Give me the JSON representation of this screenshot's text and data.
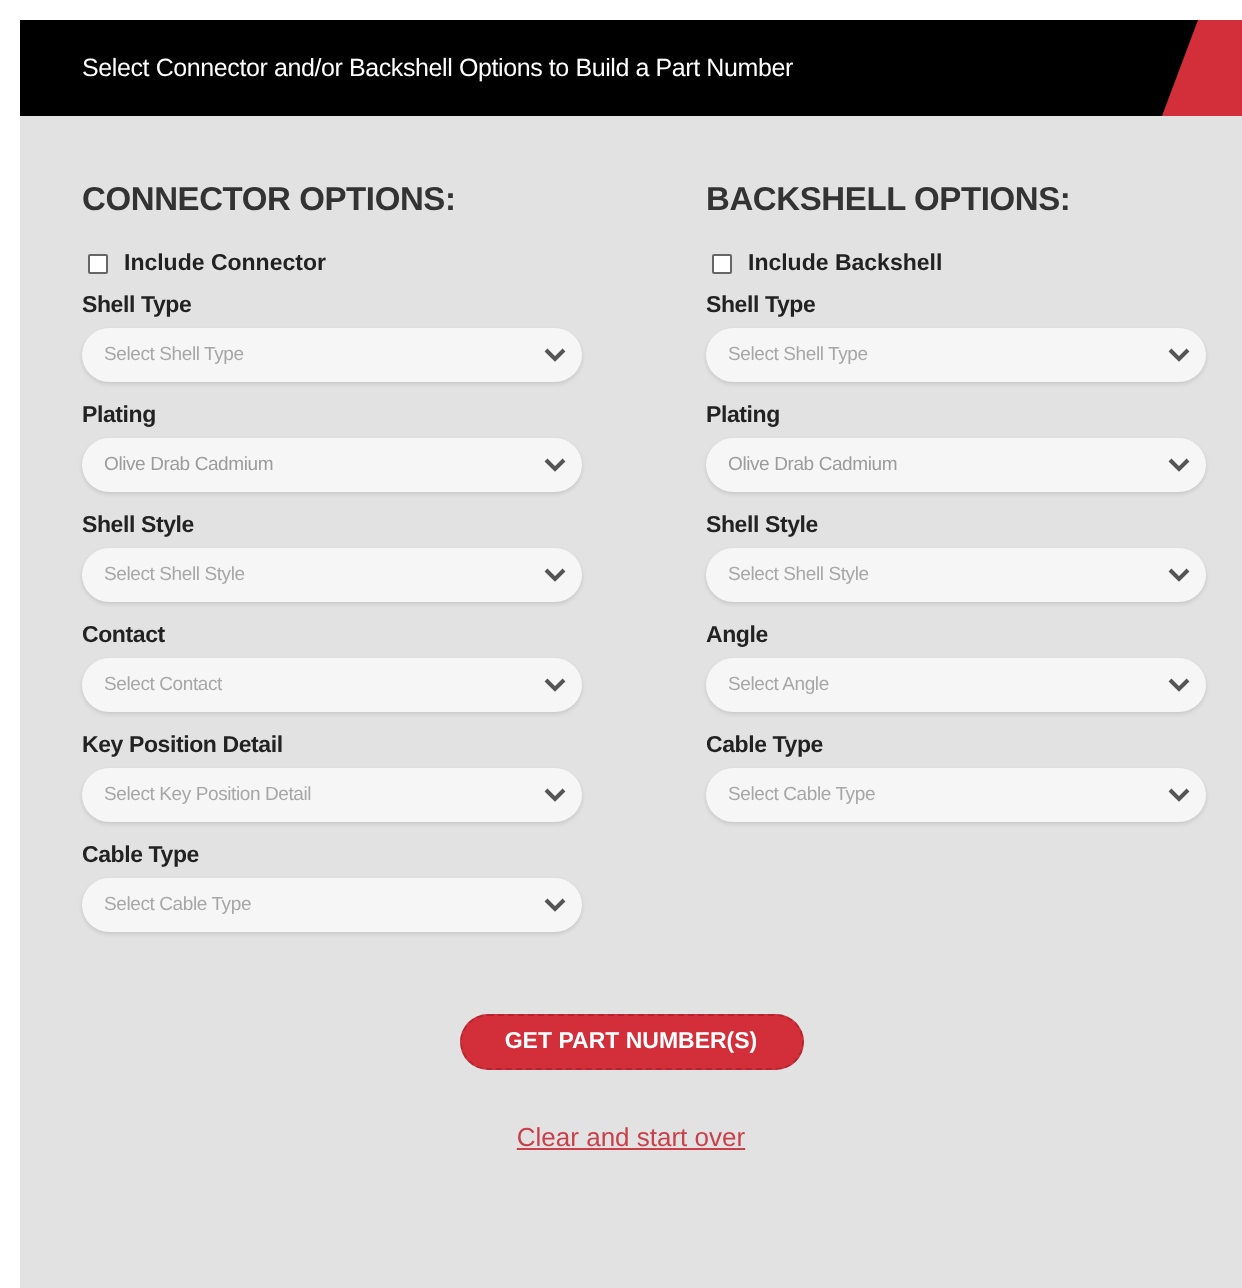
{
  "header": {
    "title": "Select Connector and/or Backshell Options to Build a Part Number"
  },
  "columns": [
    {
      "heading": "CONNECTOR OPTIONS:",
      "include": {
        "label": "Include Connector",
        "checked": false
      },
      "fields": [
        {
          "label": "Shell Type",
          "placeholder": "Select Shell Type"
        },
        {
          "label": "Plating",
          "value": "Olive Drab Cadmium"
        },
        {
          "label": "Shell Style",
          "placeholder": "Select Shell Style"
        },
        {
          "label": "Contact",
          "placeholder": "Select Contact"
        },
        {
          "label": "Key Position Detail",
          "placeholder": "Select Key Position Detail"
        },
        {
          "label": "Cable Type",
          "placeholder": "Select Cable Type"
        }
      ]
    },
    {
      "heading": "BACKSHELL OPTIONS:",
      "include": {
        "label": "Include Backshell",
        "checked": false
      },
      "fields": [
        {
          "label": "Shell Type",
          "placeholder": "Select Shell Type"
        },
        {
          "label": "Plating",
          "value": "Olive Drab Cadmium"
        },
        {
          "label": "Shell Style",
          "placeholder": "Select Shell Style"
        },
        {
          "label": "Angle",
          "placeholder": "Select Angle"
        },
        {
          "label": "Cable Type",
          "placeholder": "Select Cable Type"
        }
      ]
    }
  ],
  "submit_button": "GET PART NUMBER(S)",
  "reset_link": "Clear and start over"
}
